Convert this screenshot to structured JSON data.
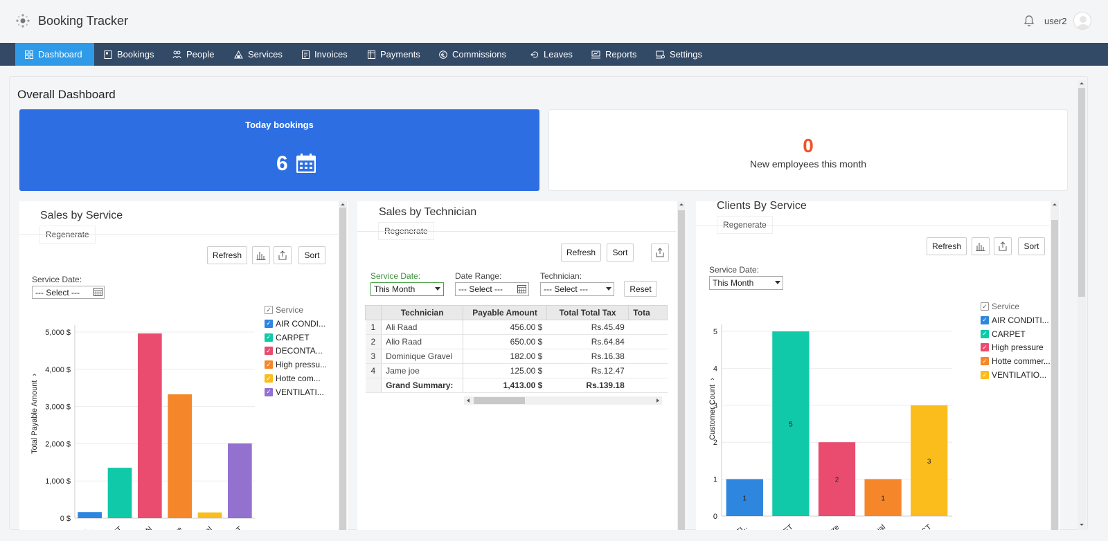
{
  "app": {
    "title": "Booking Tracker",
    "user": "user2"
  },
  "nav": [
    {
      "label": "Dashboard",
      "active": true
    },
    {
      "label": "Bookings"
    },
    {
      "label": "People"
    },
    {
      "label": "Services"
    },
    {
      "label": "Invoices"
    },
    {
      "label": "Payments"
    },
    {
      "label": "Commissions"
    },
    {
      "label": "Leaves"
    },
    {
      "label": "Reports"
    },
    {
      "label": "Settings"
    }
  ],
  "page_title": "Overall Dashboard",
  "cards": {
    "today": {
      "label": "Today bookings",
      "value": "6"
    },
    "employees": {
      "label": "New employees this month",
      "value": "0"
    }
  },
  "sales_by_service": {
    "title": "Sales by Service",
    "regenerate": "Regenerate",
    "refresh": "Refresh",
    "sort": "Sort",
    "date_label": "Service Date:",
    "date_value": "--- Select ---"
  },
  "sales_by_technician": {
    "title": "Sales by Technician",
    "regenerate": "Regenerate",
    "refresh": "Refresh",
    "sort": "Sort",
    "service_date_label": "Service Date:",
    "service_date_value": "This Month",
    "date_range_label": "Date Range:",
    "date_range_value": "--- Select ---",
    "technician_label": "Technician:",
    "technician_value": "--- Select ---",
    "reset": "Reset",
    "table": {
      "headers": [
        "Technician",
        "Payable Amount",
        "Total Total Tax",
        "Tota"
      ],
      "rows": [
        {
          "n": "1",
          "name": "Ali Raad",
          "amount": "456.00 $",
          "tax": "Rs.45.49"
        },
        {
          "n": "2",
          "name": "Alio Raad",
          "amount": "650.00 $",
          "tax": "Rs.64.84"
        },
        {
          "n": "3",
          "name": "Dominique Gravel",
          "amount": "182.00 $",
          "tax": "Rs.16.38"
        },
        {
          "n": "4",
          "name": "Jame joe",
          "amount": "125.00 $",
          "tax": "Rs.12.47"
        }
      ],
      "summary": {
        "label": "Grand Summary:",
        "amount": "1,413.00 $",
        "tax": "Rs.139.18"
      }
    }
  },
  "clients_by_service": {
    "title": "Clients By Service",
    "regenerate": "Regenerate",
    "refresh": "Refresh",
    "sort": "Sort",
    "date_label": "Service Date:",
    "date_value": "This Month"
  },
  "chart_data": [
    {
      "type": "bar",
      "ylabel": "Total Payable Amount",
      "ylim": [
        0,
        5500
      ],
      "yticks": [
        "0 $",
        "1,000 $",
        "2,000 $",
        "3,000 $",
        "4,000 $",
        "5,000 $"
      ],
      "categories": [
        "AIR CONDI...",
        "CARPET",
        "DECONTA...",
        "High pressu...",
        "Hotte com...",
        "VENTILATI..."
      ],
      "tick_labels": [
        "IO..",
        "ET",
        "ON",
        "ure",
        "ial",
        "CT"
      ],
      "values": [
        180,
        1490,
        5460,
        3660,
        170,
        2210
      ],
      "colors": [
        "#2e86de",
        "#10c9a8",
        "#ea4c6f",
        "#f5872a",
        "#fbbd1c",
        "#9271cf"
      ],
      "legend_title": "Service"
    },
    {
      "type": "bar",
      "ylabel": "Customer Count",
      "ylim": [
        0,
        5
      ],
      "yticks": [
        "0",
        "1",
        "2",
        "3",
        "4",
        "5"
      ],
      "categories": [
        "AIR CONDITI...",
        "CARPET",
        "High pressure",
        "Hotte commer...",
        "VENTILATIO..."
      ],
      "tick_labels": [
        "ITI..",
        "ET",
        "ure",
        "ial",
        "ICT"
      ],
      "values": [
        1,
        5,
        2,
        1,
        3
      ],
      "data_labels": [
        "1",
        "5",
        "2",
        "1",
        "3"
      ],
      "colors": [
        "#2e86de",
        "#10c9a8",
        "#ea4c6f",
        "#f5872a",
        "#fbbd1c"
      ],
      "legend_title": "Service"
    }
  ]
}
